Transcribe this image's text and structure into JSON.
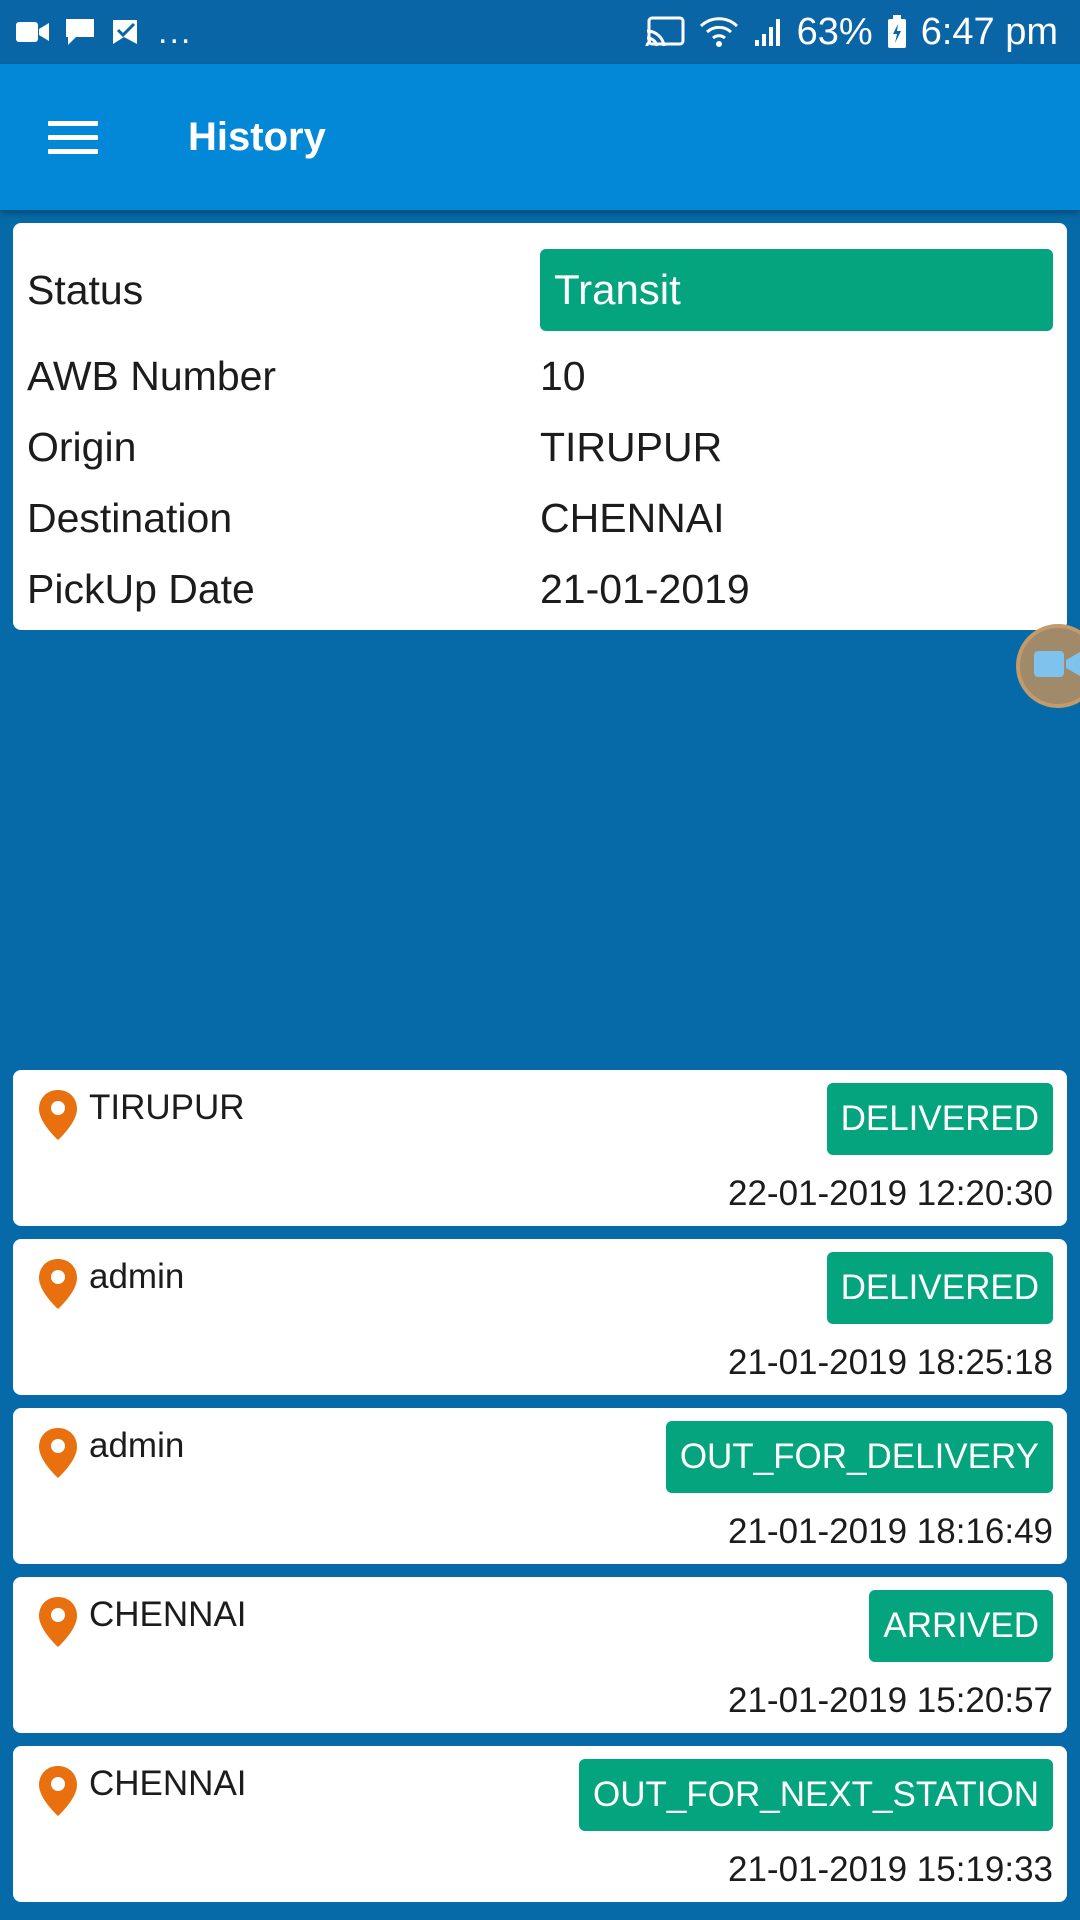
{
  "status_bar": {
    "overflow_dots": "...",
    "battery": "63%",
    "time": "6:47 pm",
    "left_icons": [
      "video-icon",
      "chat-icon",
      "checklist-icon"
    ],
    "right_icons": [
      "cast-icon",
      "wifi-icon",
      "signal-icon",
      "battery-icon"
    ]
  },
  "app_bar": {
    "title": "History",
    "menu_icon": "menu-icon"
  },
  "shipment": {
    "rows": [
      {
        "label": "Status",
        "value": "Transit"
      },
      {
        "label": "AWB Number",
        "value": "10"
      },
      {
        "label": "Origin",
        "value": "TIRUPUR"
      },
      {
        "label": "Destination",
        "value": "CHENNAI"
      },
      {
        "label": "PickUp Date",
        "value": "21-01-2019"
      }
    ]
  },
  "history": [
    {
      "location": "TIRUPUR",
      "status": "DELIVERED",
      "datetime": "22-01-2019 12:20:30"
    },
    {
      "location": "admin",
      "status": "DELIVERED",
      "datetime": "21-01-2019 18:25:18"
    },
    {
      "location": "admin",
      "status": "OUT_FOR_DELIVERY",
      "datetime": "21-01-2019 18:16:49"
    },
    {
      "location": "CHENNAI",
      "status": "ARRIVED",
      "datetime": "21-01-2019 15:20:57"
    },
    {
      "location": "CHENNAI",
      "status": "OUT_FOR_NEXT_STATION",
      "datetime": "21-01-2019 15:19:33"
    }
  ],
  "colors": {
    "status_bar": "#0965a6",
    "app_bar": "#0288d6",
    "background": "#076aa8",
    "badge": "#04a57e",
    "pin": "#e8700e"
  }
}
